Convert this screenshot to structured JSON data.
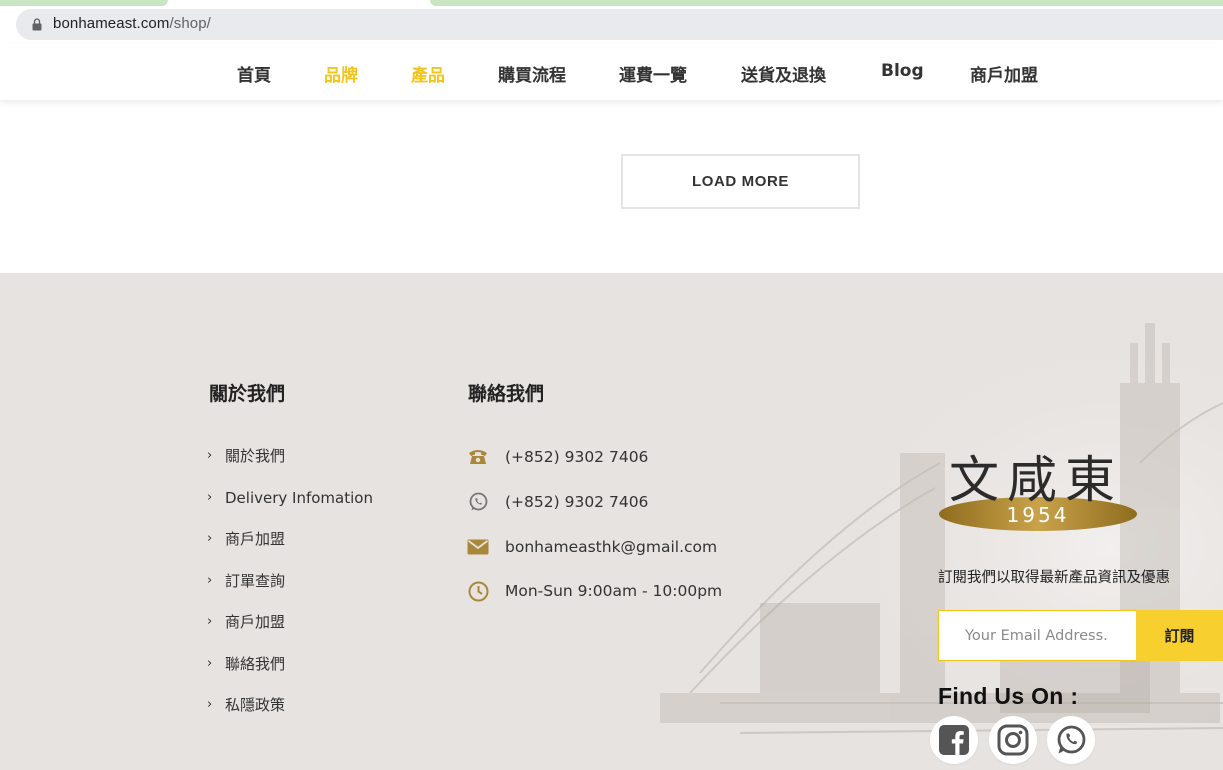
{
  "browser": {
    "url_domain": "bonhameast.com",
    "url_path": "/shop/"
  },
  "nav": {
    "items": [
      {
        "label": "首頁",
        "active": false
      },
      {
        "label": "品牌",
        "active": true
      },
      {
        "label": "產品",
        "active": true
      },
      {
        "label": "購買流程",
        "active": false
      },
      {
        "label": "運費一覽",
        "active": false
      },
      {
        "label": "送貨及退換",
        "active": false
      },
      {
        "label": "Blog",
        "active": false
      },
      {
        "label": "商戶加盟",
        "active": false
      }
    ]
  },
  "shop": {
    "load_more_label": "LOAD MORE"
  },
  "footer": {
    "about": {
      "title": "關於我們",
      "links": [
        "關於我們",
        "Delivery Infomation",
        "商戶加盟",
        "訂單查詢",
        "商戶加盟",
        "聯絡我們",
        "私隱政策"
      ]
    },
    "contact": {
      "title": "聯絡我們",
      "items": [
        {
          "icon": "phone-icon",
          "text": "(+852) 9302 7406"
        },
        {
          "icon": "whatsapp-icon",
          "text": "(+852) 9302 7406"
        },
        {
          "icon": "email-icon",
          "text": "bonhameasthk@gmail.com"
        },
        {
          "icon": "clock-icon",
          "text": "Mon-Sun 9:00am - 10:00pm"
        }
      ]
    },
    "logo": {
      "chinese": "文咸東",
      "year": "1954"
    },
    "subscribe": {
      "text": "訂閱我們以取得最新產品資訊及優惠",
      "placeholder": "Your Email Address.",
      "button": "訂閱"
    },
    "find_us": "Find Us On :",
    "social": [
      "facebook-icon",
      "instagram-icon",
      "whatsapp-icon"
    ]
  },
  "colors": {
    "accent_yellow": "#f3c41a",
    "subscribe_yellow": "#f7cf2f",
    "icon_gold": "#a8883a",
    "footer_bg": "#e7e3e1"
  }
}
